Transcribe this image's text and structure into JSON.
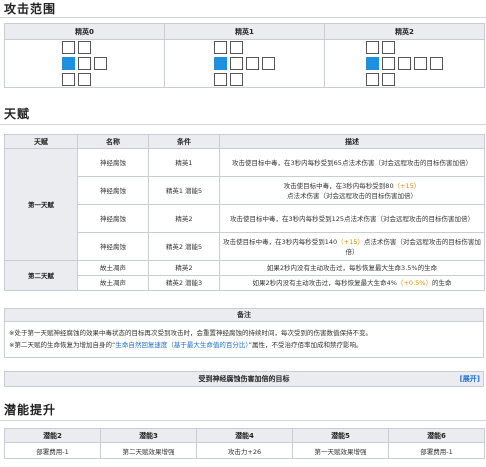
{
  "range": {
    "title": "攻击范围",
    "headers": [
      "精英0",
      "精英1",
      "精英2"
    ],
    "grids": [
      [
        "rre",
        "srr",
        "rre"
      ],
      [
        "rree",
        "srrr",
        "rree"
      ],
      [
        "rreee",
        "srrrr",
        "rreee"
      ]
    ]
  },
  "talent": {
    "title": "天赋",
    "headers": [
      "天赋",
      "名称",
      "条件",
      "描述"
    ],
    "groups": [
      {
        "tier": "第一天赋",
        "rows": [
          {
            "name": "神经腐蚀",
            "cond": "精英1",
            "desc": "攻击使目标中毒，在3秒内每秒受到65点法术伤害（对会远程攻击的目标伤害加倍）",
            "desc_a": "",
            "bonus": "",
            "desc_b": ""
          },
          {
            "name": "神经腐蚀",
            "cond": "精英1 潜能5",
            "desc": "",
            "desc_a": "攻击使目标中毒，在3秒内每秒受到80",
            "bonus": "（+15）",
            "desc_b": "点法术伤害（对会远程攻击的目标伤害加倍）"
          },
          {
            "name": "神经腐蚀",
            "cond": "精英2",
            "desc": "攻击使目标中毒，在3秒内每秒受到125点法术伤害（对会远程攻击的目标伤害加倍）",
            "desc_a": "",
            "bonus": "",
            "desc_b": ""
          },
          {
            "name": "神经腐蚀",
            "cond": "精英2 潜能5",
            "desc": "",
            "desc_a": "攻击使目标中毒，在3秒内每秒受到140",
            "bonus": "（+15）",
            "desc_b": "点法术伤害（对会远程攻击的目标伤害加倍）"
          }
        ]
      },
      {
        "tier": "第二天赋",
        "rows": [
          {
            "name": "故土凋声",
            "cond": "精英2",
            "desc": "如果2秒内没有主动攻击过，每秒恢复最大生命3.5%的生命",
            "desc_a": "",
            "bonus": "",
            "desc_b": ""
          },
          {
            "name": "故土凋声",
            "cond": "精英2 潜能3",
            "desc": "",
            "desc_a": "如果2秒内没有主动攻击过，每秒恢复最大生命4%",
            "bonus": "（+0.5%）",
            "desc_b": "的生命"
          }
        ]
      }
    ],
    "notes_title": "备注",
    "notes": [
      {
        "a": "※处于第一天赋神经腐蚀的效果中毒状态的目标再次受到攻击时，会重置神经腐蚀的持续时间，每次受到的伤害数值保持不变。",
        "link": "",
        "b": ""
      },
      {
        "a": "※第二天赋的生命恢复为增加自身的“",
        "link": "生命自然回复速度（基于最大生命值的百分比）",
        "b": "”属性，不受治疗佰率加成和禁疗影响。"
      }
    ],
    "collapse_label": "受到神经腐蚀伤害加倍的目标",
    "collapse_toggle": "[展开]"
  },
  "potential": {
    "title": "潜能提升",
    "headers": [
      "潜能2",
      "潜能3",
      "潜能4",
      "潜能5",
      "潜能6"
    ],
    "values": [
      "部署费用-1",
      "第二天赋效果增强",
      "攻击力+26",
      "第一天赋效果增强",
      "部署费用-1"
    ]
  },
  "colors": {
    "selected_tile": "#1e90e0",
    "bonus_text": "#f08a00",
    "link_text": "#1a6fd1",
    "header_bg": "#eaecf0"
  }
}
